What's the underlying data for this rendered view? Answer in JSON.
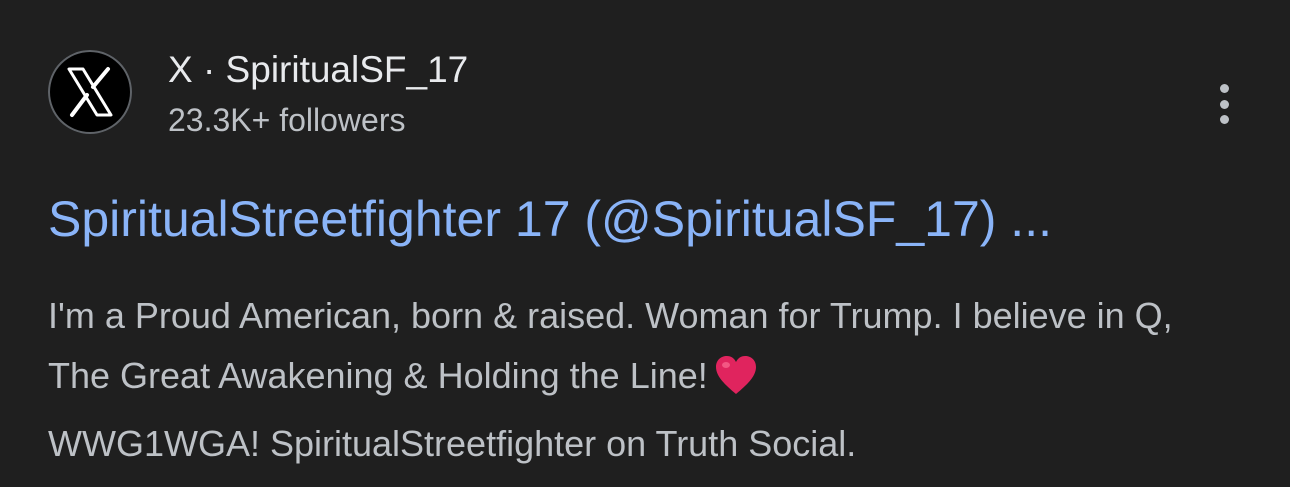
{
  "result": {
    "source_line": "X · SpiritualSF_17",
    "followers": "23.3K+ followers",
    "title": "SpiritualStreetfighter 17 (@SpiritualSF_17) ...",
    "snippet_part1": "I'm a Proud American, born & raised. Woman for Trump. I believe in Q, The Great Awakening & Holding the Line!",
    "snippet_part2": "WWG1WGA! SpiritualStreetfighter on Truth Social.",
    "avatar_icon": "x-logo-icon",
    "menu_icon": "more-vertical-icon",
    "emoji_icon": "red-heart-icon"
  },
  "colors": {
    "background": "#1f1f1f",
    "title": "#8ab4f8",
    "primary_text": "#e8eaed",
    "secondary_text": "#bdc1c6",
    "heart": "#e0245e"
  }
}
